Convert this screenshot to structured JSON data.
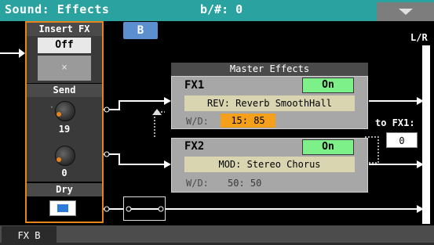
{
  "header": {
    "title": "Sound: Effects",
    "accidentals": "b/#: 0"
  },
  "insert_fx": {
    "label": "Insert FX",
    "off_button": "Off",
    "slot_button": "×"
  },
  "send": {
    "label": "Send",
    "knob1_value": "19",
    "knob2_value": "0"
  },
  "dry": {
    "label": "Dry"
  },
  "bus_button": "B",
  "master_effects": {
    "header": "Master Effects",
    "fx1": {
      "name": "FX1",
      "state": "On",
      "preset": "REV: Reverb SmoothHall",
      "wd_label": "W/D:",
      "wd_value": "15: 85"
    },
    "fx2": {
      "name": "FX2",
      "state": "On",
      "preset": "MOD: Stereo Chorus",
      "wd_label": "W/D:",
      "wd_value": "50: 50"
    }
  },
  "to_fx1": {
    "label": "to FX1:",
    "value": "0"
  },
  "output": {
    "label": "L/R"
  },
  "tabs": [
    {
      "label": "FX B"
    }
  ],
  "colors": {
    "header": "#2aa3a0",
    "accent": "#e8821a",
    "on": "#7ef08a",
    "wd_active": "#f5a01a",
    "bus_button": "#5b8fd0"
  }
}
